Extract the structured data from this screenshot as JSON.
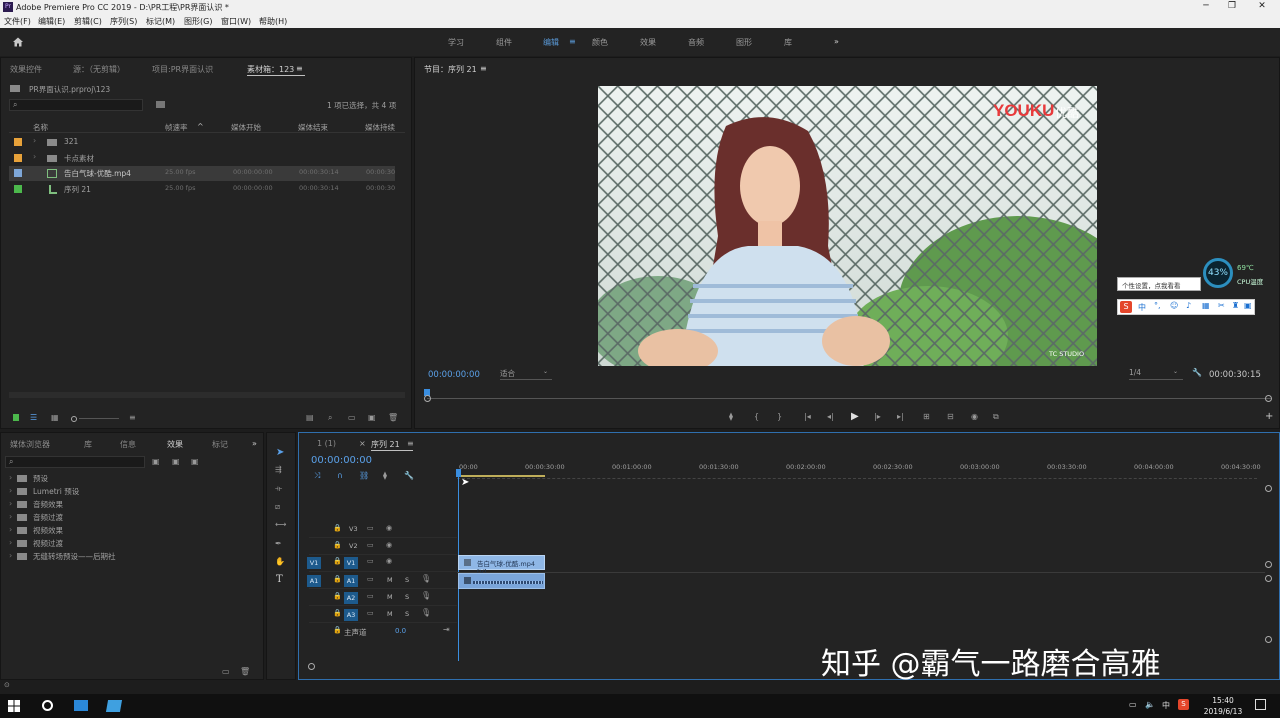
{
  "window": {
    "title": "Adobe Premiere Pro CC 2019 - D:\\PR工程\\PR界面认识 *",
    "icon": "Pr",
    "controls": [
      "─",
      "❐",
      "✕"
    ]
  },
  "menu": [
    "文件(F)",
    "编辑(E)",
    "剪辑(C)",
    "序列(S)",
    "标记(M)",
    "图形(G)",
    "窗口(W)",
    "帮助(H)"
  ],
  "workspaces": {
    "items": [
      "学习",
      "组件",
      "编辑",
      "颜色",
      "效果",
      "音频",
      "图形",
      "库"
    ],
    "active": "编辑",
    "more": "»"
  },
  "project_panel": {
    "tabs": [
      "效果控件",
      "源：（无剪辑）",
      "项目:PR界面认识",
      "素材箱：123"
    ],
    "menu_icon": "≡",
    "path": "PR界面认识.prproj\\123",
    "search_placeholder": "",
    "selection_info": "1 项已选择，共 4 项",
    "columns": [
      "名称",
      "帧速率",
      "媒体开始",
      "媒体结束",
      "媒体持续"
    ],
    "rows": [
      {
        "color": "#e8a23a",
        "name": "321",
        "fps": "",
        "start": "",
        "end": "",
        "dur": "",
        "type": "folder"
      },
      {
        "color": "#e8a23a",
        "name": "卡点素材",
        "fps": "",
        "start": "",
        "end": "",
        "dur": "",
        "type": "folder"
      },
      {
        "color": "#7ea7d8",
        "name": "告白气球-优酷.mp4",
        "fps": "25.00 fps",
        "start": "00:00:00:00",
        "end": "00:00:30:14",
        "dur": "00:00:30",
        "type": "clip"
      },
      {
        "color": "#4cb84c",
        "name": "序列 21",
        "fps": "25.00 fps",
        "start": "00:00:00:00",
        "end": "00:00:30:14",
        "dur": "00:00:30",
        "type": "sequence"
      }
    ]
  },
  "program_monitor": {
    "title": "节目：序列 21",
    "menu_icon": "≡",
    "timecode": "00:00:00:00",
    "fit": "适合",
    "resolution": "1/4",
    "duration": "00:00:30:15",
    "watermark_brand": "YOUKU",
    "watermark_brand_cn": "优酷",
    "studio_logo": "TC STUDIO"
  },
  "overlay": {
    "cpu_percent": "43%",
    "cpu_temp": "69℃",
    "cpu_label": "CPU温度",
    "ime_tip": "个性设置，点我看看",
    "ime_lang": "中"
  },
  "effects_panel": {
    "tabs": [
      "媒体浏览器",
      "库",
      "信息",
      "效果",
      "标记"
    ],
    "more": "»",
    "items": [
      "预设",
      "Lumetri 预设",
      "音频效果",
      "音频过渡",
      "视频效果",
      "视频过渡",
      "无缝转场预设——后期社"
    ]
  },
  "timeline": {
    "tabs": [
      "1 (1)",
      "序列 21"
    ],
    "timecode": "00:00:00:00",
    "ruler": [
      "00:00",
      "00:00:30:00",
      "00:01:00:00",
      "00:01:30:00",
      "00:02:00:00",
      "00:02:30:00",
      "00:03:00:00",
      "00:03:30:00",
      "00:04:00:00",
      "00:04:30:00"
    ],
    "video_tracks": [
      "V3",
      "V2",
      "V1"
    ],
    "audio_tracks": [
      "A1",
      "A2",
      "A3"
    ],
    "source_v": "V1",
    "source_a": "A1",
    "mute": "M",
    "solo": "S",
    "master": "主声道",
    "master_value": "0.0",
    "clip_label": "告白气球-优酷.mp4 [V]"
  },
  "watermark": "知乎 @霸气一路磨合高雅",
  "taskbar": {
    "time": "15:40",
    "date": "2019/6/13",
    "tray_lang": "中"
  }
}
